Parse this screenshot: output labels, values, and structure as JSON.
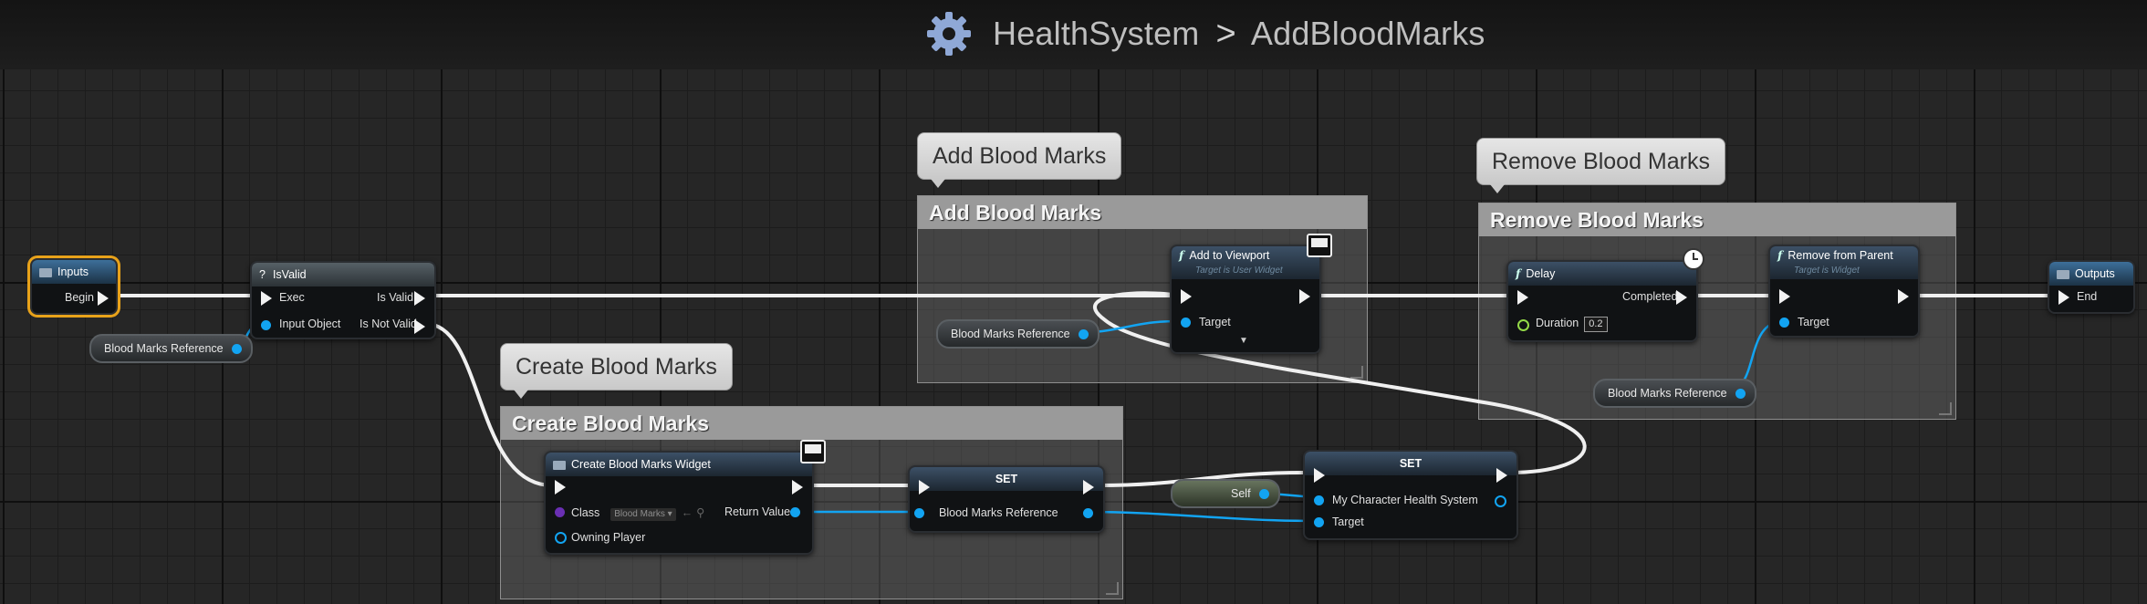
{
  "breadcrumb": {
    "icon": "gear-icon",
    "parent": "HealthSystem",
    "separator": ">",
    "current": "AddBloodMarks"
  },
  "comments": {
    "add": {
      "bubble": "Add Blood Marks",
      "title": "Add Blood Marks"
    },
    "remove": {
      "bubble": "Remove Blood Marks",
      "title": "Remove Blood Marks"
    },
    "create": {
      "bubble": "Create Blood Marks",
      "title": "Create Blood Marks"
    }
  },
  "nodes": {
    "inputs": {
      "title": "Inputs",
      "begin": "Begin"
    },
    "isvalid": {
      "icon": "?",
      "title": "IsValid",
      "exec": "Exec",
      "input": "Input Object",
      "is_valid": "Is Valid",
      "is_not_valid": "Is Not Valid"
    },
    "add_viewport": {
      "title": "Add to Viewport",
      "subtitle": "Target is User Widget",
      "target": "Target"
    },
    "delay": {
      "title": "Delay",
      "completed": "Completed",
      "duration_label": "Duration",
      "duration_value": "0.2"
    },
    "remove_parent": {
      "title": "Remove from Parent",
      "subtitle": "Target is Widget",
      "target": "Target"
    },
    "outputs": {
      "title": "Outputs",
      "end": "End"
    },
    "create_widget": {
      "title": "Create Blood Marks Widget",
      "class_label": "Class",
      "class_value": "Blood Marks",
      "return_value": "Return Value",
      "owning_player": "Owning Player"
    },
    "set1": {
      "title": "SET",
      "var": "Blood Marks Reference"
    },
    "set2": {
      "title": "SET",
      "var": "My Character Health System",
      "target": "Target"
    }
  },
  "vars": {
    "ref1": "Blood Marks Reference",
    "ref2": "Blood Marks Reference",
    "ref3": "Blood Marks Reference",
    "self": "Self"
  },
  "colors": {
    "exec": "#f2f2f2",
    "object_pin": "#12a4f2",
    "float_pin": "#94d948",
    "class_pin": "#6a2fb3",
    "selection": "#e8a21a"
  }
}
